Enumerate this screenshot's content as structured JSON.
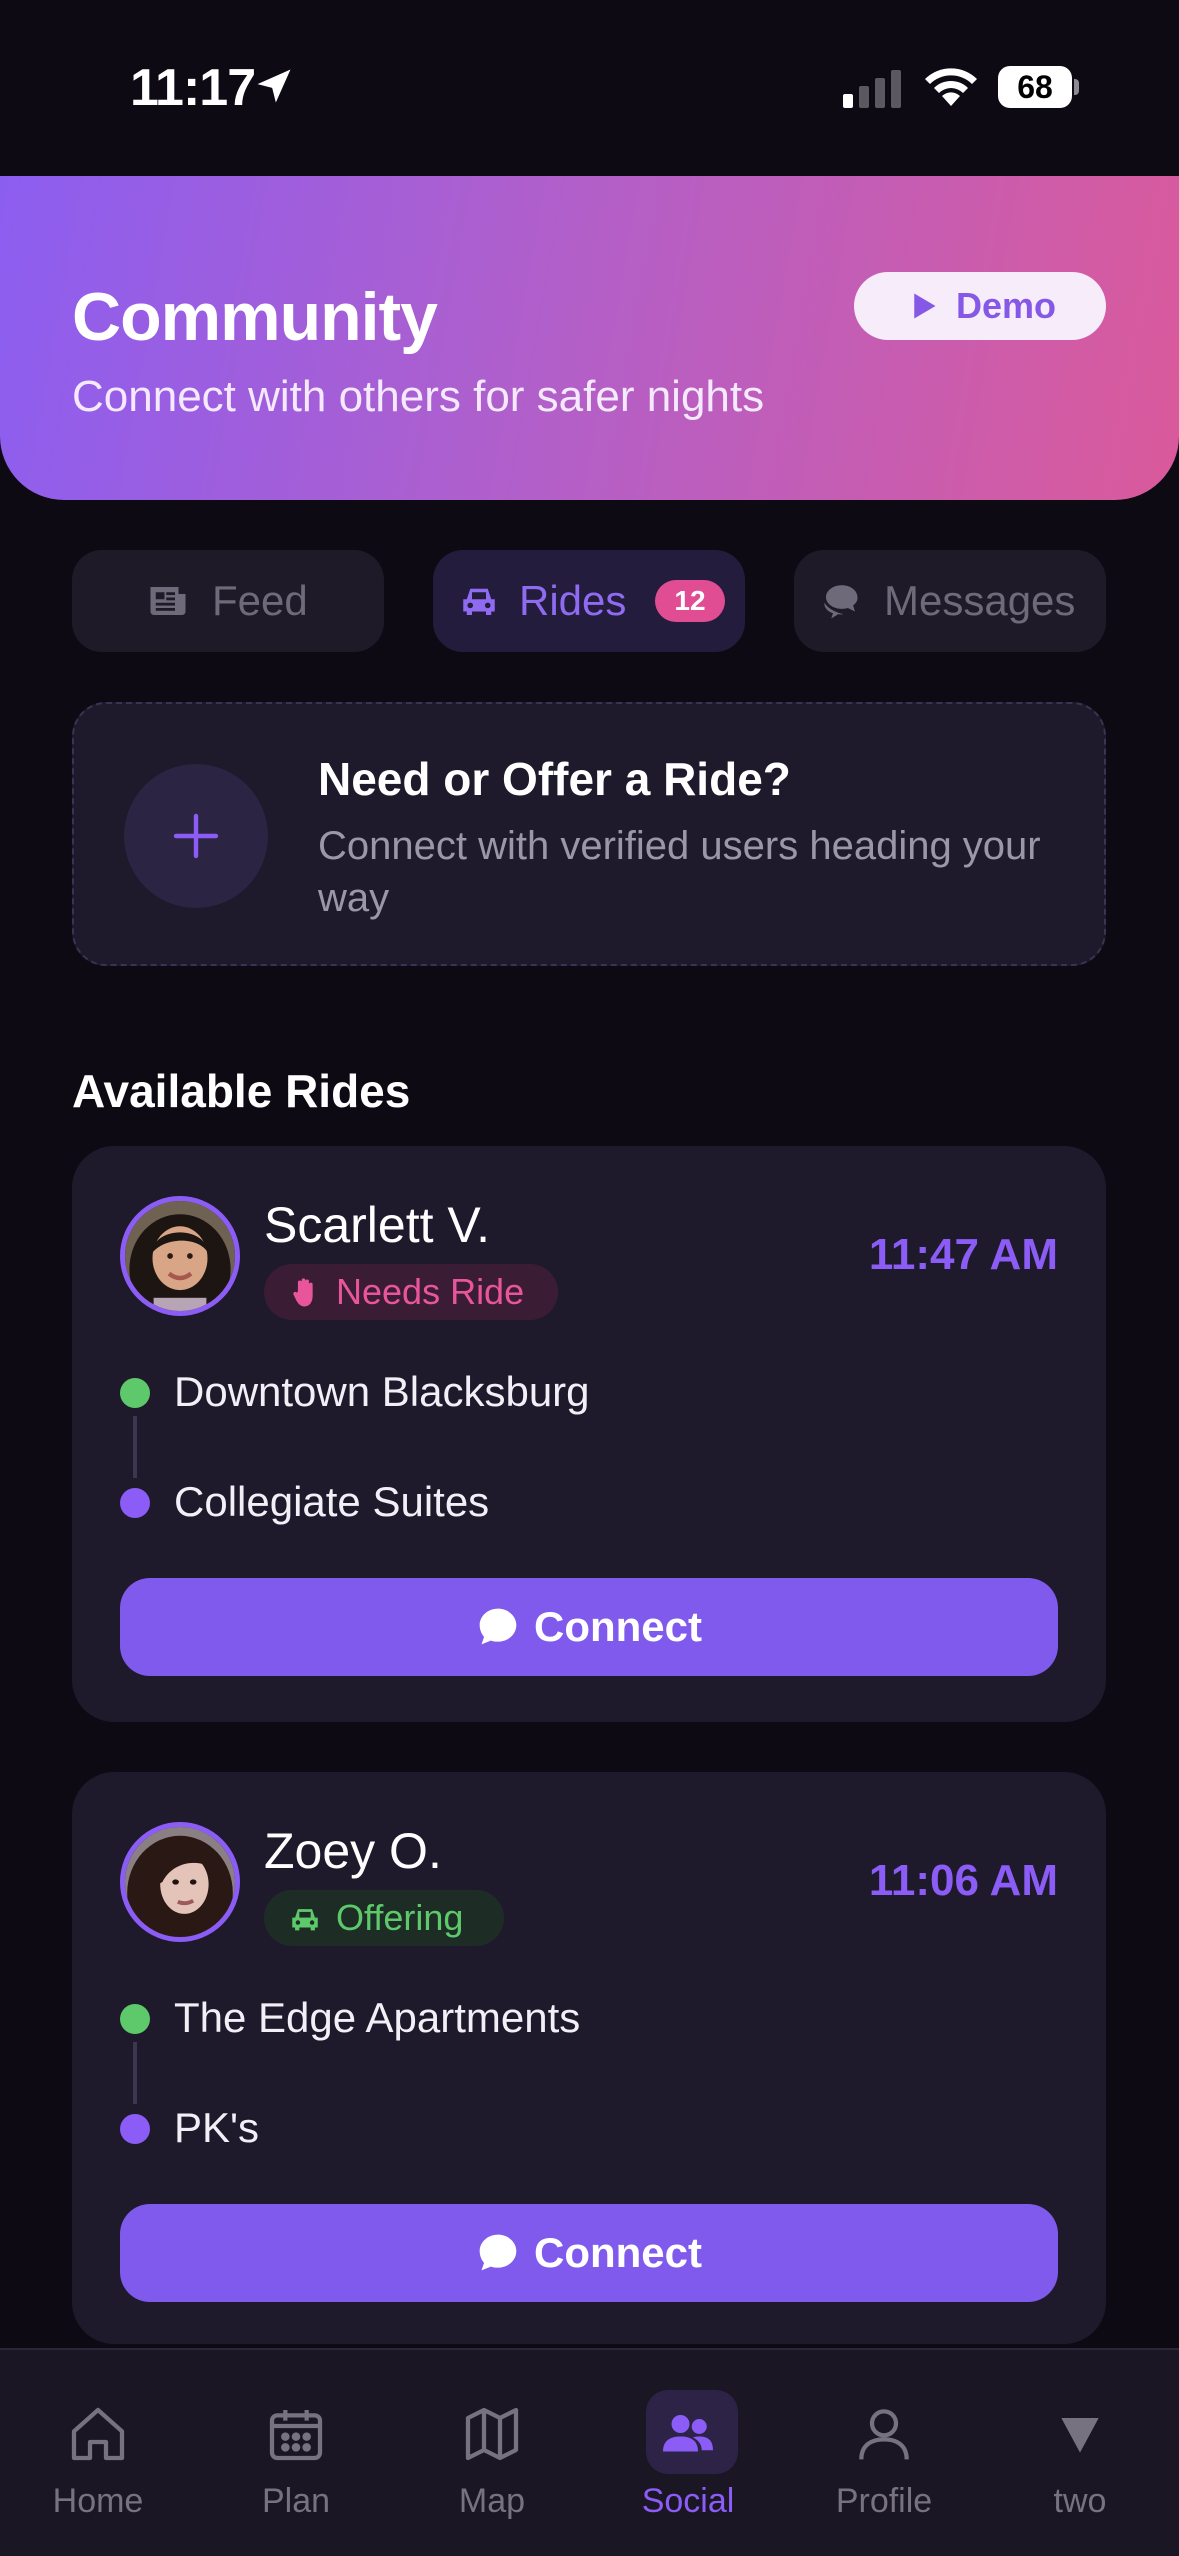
{
  "status_bar": {
    "time": "11:17",
    "battery": "68"
  },
  "header": {
    "title": "Community",
    "subtitle": "Connect with others for safer nights",
    "demo_label": "Demo"
  },
  "tabs": [
    {
      "label": "Feed",
      "icon": "newspaper-icon"
    },
    {
      "label": "Rides",
      "icon": "car-icon",
      "badge": "12",
      "active": true
    },
    {
      "label": "Messages",
      "icon": "chat-bubbles-icon"
    }
  ],
  "cta": {
    "title": "Need or Offer a Ride?",
    "subtitle": "Connect with verified users heading your way"
  },
  "section_title": "Available Rides",
  "rides": [
    {
      "name": "Scarlett V.",
      "status": "Needs Ride",
      "status_icon": "hand-icon",
      "time": "11:47 AM",
      "from": "Downtown Blacksburg",
      "to": "Collegiate Suites",
      "action": "Connect"
    },
    {
      "name": "Zoey O.",
      "status": "Offering",
      "status_icon": "car-icon",
      "time": "11:06 AM",
      "from": "The Edge Apartments",
      "to": "PK's",
      "action": "Connect"
    }
  ],
  "nav": [
    {
      "label": "Home",
      "icon": "home-icon"
    },
    {
      "label": "Plan",
      "icon": "calendar-icon"
    },
    {
      "label": "Map",
      "icon": "map-icon"
    },
    {
      "label": "Social",
      "icon": "people-icon",
      "active": true
    },
    {
      "label": "Profile",
      "icon": "person-icon"
    },
    {
      "label": "two",
      "icon": "triangle-down-icon"
    }
  ],
  "colors": {
    "accent": "#8b5cf6",
    "background": "#0d0a14",
    "card": "#1e1a2c",
    "needs_ride": "#e8559a",
    "offering": "#5dc96a"
  }
}
